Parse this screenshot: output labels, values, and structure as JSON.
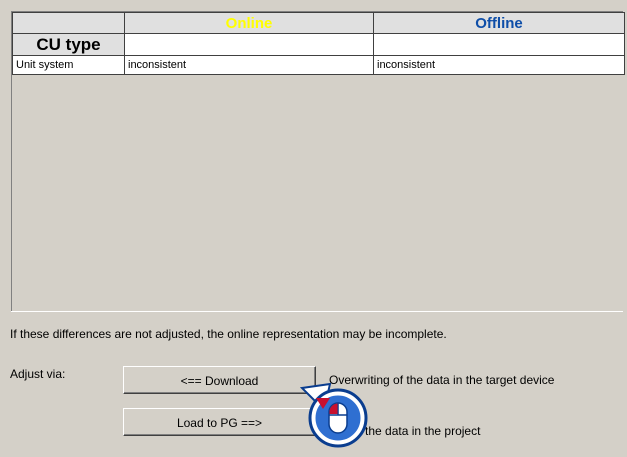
{
  "table": {
    "headers": [
      "",
      "Online",
      "Offline"
    ],
    "subheader": "CU type",
    "rows": [
      [
        "Unit system",
        "inconsistent",
        "inconsistent"
      ]
    ]
  },
  "message": "If these differences are not adjusted, the online representation may be incomplete.",
  "adjust": {
    "label": "Adjust via:",
    "download_label": "<== Download",
    "download_desc": "Overwriting of the data in the target device",
    "load_label": "Load to PG ==>",
    "load_desc": "ting of the data in the project"
  },
  "colors": {
    "online": "#ffff00",
    "offline": "#0e4ea8",
    "background": "#d4d0c8"
  },
  "icons": [
    "mouse-left-click-icon"
  ]
}
